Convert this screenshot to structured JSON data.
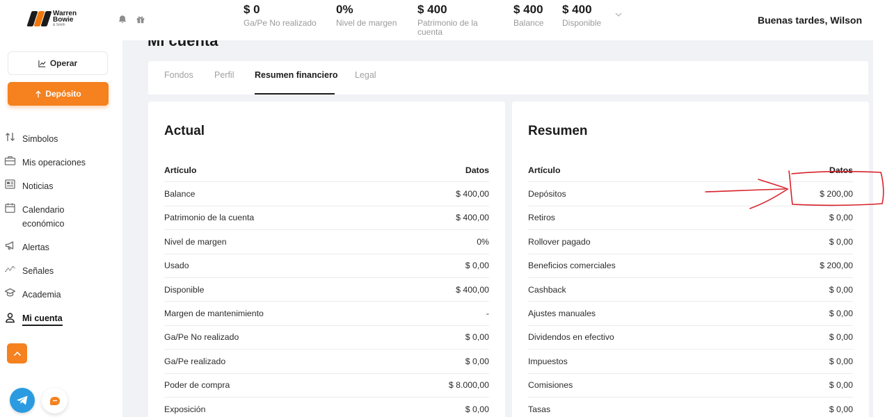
{
  "brand": {
    "line1": "Warren",
    "line2": "Bowie",
    "line3": "& Smith"
  },
  "header": {
    "stats": [
      {
        "value": "$ 0",
        "label": "Ga/Pe No realizado"
      },
      {
        "value": "0%",
        "label": "Nivel de margen"
      },
      {
        "value": "$ 400",
        "label": "Patrimonio de la cuenta"
      },
      {
        "value": "$ 400",
        "label": "Balance"
      },
      {
        "value": "$ 400",
        "label": "Disponible"
      }
    ],
    "greeting": "Buenas tardes, Wilson"
  },
  "sidebar": {
    "operar_label": "Operar",
    "deposito_label": "Depósito",
    "items": [
      {
        "label": "Simbolos",
        "icon": "arrows-updown-icon"
      },
      {
        "label": "Mis operaciones",
        "icon": "briefcase-icon"
      },
      {
        "label": "Noticias",
        "icon": "newspaper-icon"
      },
      {
        "label": "Calendario económico",
        "icon": "calendar-icon"
      },
      {
        "label": "Alertas",
        "icon": "megaphone-icon"
      },
      {
        "label": "Señales",
        "icon": "signal-chart-icon"
      },
      {
        "label": "Academia",
        "icon": "graduation-cap-icon"
      },
      {
        "label": "Mi cuenta",
        "icon": "user-icon"
      }
    ]
  },
  "page": {
    "title": "Mi cuenta"
  },
  "tabs": [
    "Fondos",
    "Perfil",
    "Resumen financiero",
    "Legal"
  ],
  "active_tab": "Resumen financiero",
  "actual": {
    "title": "Actual",
    "col_item": "Artículo",
    "col_data": "Datos",
    "rows": [
      {
        "label": "Balance",
        "value": "$ 400,00"
      },
      {
        "label": "Patrimonio de la cuenta",
        "value": "$ 400,00"
      },
      {
        "label": "Nivel de margen",
        "value": "0%"
      },
      {
        "label": "Usado",
        "value": "$ 0,00"
      },
      {
        "label": "Disponible",
        "value": "$ 400,00"
      },
      {
        "label": "Margen de mantenimiento",
        "value": "-"
      },
      {
        "label": "Ga/Pe No realizado",
        "value": "$ 0,00"
      },
      {
        "label": "Ga/Pe realizado",
        "value": "$ 0,00"
      },
      {
        "label": "Poder de compra",
        "value": "$ 8.000,00"
      },
      {
        "label": "Exposición",
        "value": "$ 0,00"
      }
    ]
  },
  "resumen": {
    "title": "Resumen",
    "col_item": "Artículo",
    "col_data": "Datos",
    "rows": [
      {
        "label": "Depósitos",
        "value": "$ 200,00"
      },
      {
        "label": "Retiros",
        "value": "$ 0,00"
      },
      {
        "label": "Rollover pagado",
        "value": "$ 0,00"
      },
      {
        "label": "Beneficios comerciales",
        "value": "$ 200,00"
      },
      {
        "label": "Cashback",
        "value": "$ 0,00"
      },
      {
        "label": "Ajustes manuales",
        "value": "$ 0,00"
      },
      {
        "label": "Dividendos en efectivo",
        "value": "$ 0,00"
      },
      {
        "label": "Impuestos",
        "value": "$ 0,00"
      },
      {
        "label": "Comisiones",
        "value": "$ 0,00"
      },
      {
        "label": "Tasas",
        "value": "$ 0,00"
      }
    ]
  },
  "colors": {
    "accent": "#f5811f",
    "annotation": "#d8202a",
    "telegram": "#2a9be0"
  }
}
